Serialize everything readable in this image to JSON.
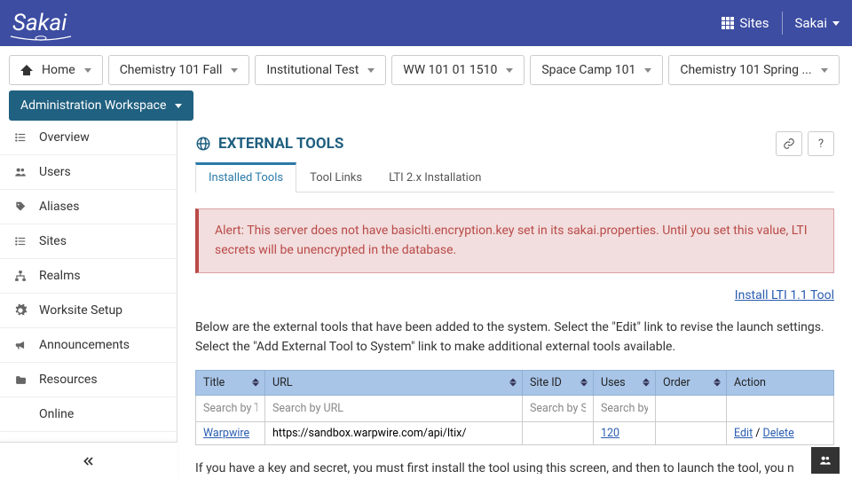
{
  "brand": "Sakai",
  "topbar": {
    "sites": "Sites",
    "user": "Sakai"
  },
  "site_tabs": [
    {
      "label": "Home",
      "home": true
    },
    {
      "label": "Chemistry 101 Fall"
    },
    {
      "label": "Institutional Test"
    },
    {
      "label": "WW 101 01 1510"
    },
    {
      "label": "Space Camp 101"
    },
    {
      "label": "Chemistry 101 Spring ..."
    },
    {
      "label": "Administration Workspace",
      "active": true
    }
  ],
  "sidebar": [
    {
      "label": "Overview",
      "icon": "list"
    },
    {
      "label": "Users",
      "icon": "users"
    },
    {
      "label": "Aliases",
      "icon": "tag"
    },
    {
      "label": "Sites",
      "icon": "list"
    },
    {
      "label": "Realms",
      "icon": "sitemap"
    },
    {
      "label": "Worksite Setup",
      "icon": "gear"
    },
    {
      "label": "Announcements",
      "icon": "megaphone"
    },
    {
      "label": "Resources",
      "icon": "folder"
    },
    {
      "label": "Online",
      "icon": "blank"
    }
  ],
  "page": {
    "title": "EXTERNAL TOOLS",
    "tabs": [
      "Installed Tools",
      "Tool Links",
      "LTI 2.x Installation"
    ],
    "active_tab": 0,
    "alert": "Alert: This server does not have basiclti.encryption.key set in its sakai.properties. Until you set this value, LTI secrets will be unencrypted in the database.",
    "install_link": "Install LTI 1.1 Tool",
    "intro": "Below are the external tools that have been added to the system. Select the \"Edit\" link to revise the launch settings. Select the \"Add External Tool to System\" link to make additional external tools available.",
    "columns": [
      "Title",
      "URL",
      "Site ID",
      "Uses",
      "Order",
      "Action"
    ],
    "search_placeholders": [
      "Search by Title",
      "Search by URL",
      "Search by Site ID",
      "Search by Uses",
      "",
      ""
    ],
    "rows": [
      {
        "title": "Warpwire",
        "url": "https://sandbox.warpwire.com/api/ltix/",
        "site_id": "",
        "uses": "120",
        "order": "",
        "edit": "Edit",
        "delete": "Delete"
      }
    ],
    "footer": "If you have a key and secret, you must first install the tool using this screen, and then to launch the tool, you n"
  }
}
